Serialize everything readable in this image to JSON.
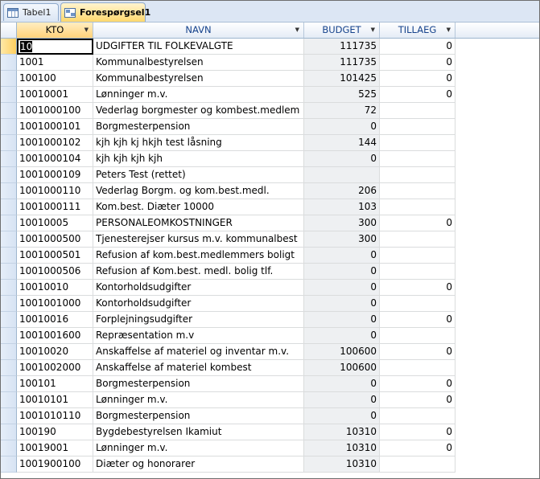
{
  "tabs": [
    {
      "label": "Tabel1",
      "icon": "table-icon",
      "active": false
    },
    {
      "label": "Forespørgsel1",
      "icon": "query-icon",
      "active": true
    }
  ],
  "columns": [
    {
      "label": "KTO"
    },
    {
      "label": "NAVN"
    },
    {
      "label": "BUDGET"
    },
    {
      "label": "TILLAEG"
    }
  ],
  "rows": [
    {
      "kto": "10",
      "navn": "UDGIFTER TIL FOLKEVALGTE",
      "budget": "111735",
      "tillaeg": "0"
    },
    {
      "kto": "1001",
      "navn": "Kommunalbestyrelsen",
      "budget": "111735",
      "tillaeg": "0"
    },
    {
      "kto": "100100",
      "navn": "Kommunalbestyrelsen",
      "budget": "101425",
      "tillaeg": "0"
    },
    {
      "kto": "10010001",
      "navn": "Lønninger m.v.",
      "budget": "525",
      "tillaeg": "0"
    },
    {
      "kto": "1001000100",
      "navn": "Vederlag borgmester og kombest.medlem",
      "budget": "72",
      "tillaeg": ""
    },
    {
      "kto": "1001000101",
      "navn": "Borgmesterpension",
      "budget": "0",
      "tillaeg": ""
    },
    {
      "kto": "1001000102",
      "navn": "kjh kjh kj hkjh test låsning",
      "budget": "144",
      "tillaeg": ""
    },
    {
      "kto": "1001000104",
      "navn": "kjh kjh kjh kjh",
      "budget": "0",
      "tillaeg": ""
    },
    {
      "kto": "1001000109",
      "navn": "Peters Test (rettet)",
      "budget": "",
      "tillaeg": ""
    },
    {
      "kto": "1001000110",
      "navn": "Vederlag Borgm. og kom.best.medl.",
      "budget": "206",
      "tillaeg": ""
    },
    {
      "kto": "1001000111",
      "navn": "Kom.best. Diæter 10000",
      "budget": "103",
      "tillaeg": ""
    },
    {
      "kto": "10010005",
      "navn": "PERSONALEOMKOSTNINGER",
      "budget": "300",
      "tillaeg": "0"
    },
    {
      "kto": "1001000500",
      "navn": "Tjenesterejser kursus m.v. kommunalbest",
      "budget": "300",
      "tillaeg": ""
    },
    {
      "kto": "1001000501",
      "navn": "Refusion af kom.best.medlemmers boligt",
      "budget": "0",
      "tillaeg": ""
    },
    {
      "kto": "1001000506",
      "navn": "Refusion af Kom.best. medl. bolig tlf.",
      "budget": "0",
      "tillaeg": ""
    },
    {
      "kto": "10010010",
      "navn": "Kontorholdsudgifter",
      "budget": "0",
      "tillaeg": "0"
    },
    {
      "kto": "1001001000",
      "navn": "Kontorholdsudgifter",
      "budget": "0",
      "tillaeg": ""
    },
    {
      "kto": "10010016",
      "navn": "Forplejningsudgifter",
      "budget": "0",
      "tillaeg": "0"
    },
    {
      "kto": "1001001600",
      "navn": "Repræsentation m.v",
      "budget": "0",
      "tillaeg": ""
    },
    {
      "kto": "10010020",
      "navn": "Anskaffelse af materiel og inventar m.v.",
      "budget": "100600",
      "tillaeg": "0"
    },
    {
      "kto": "1001002000",
      "navn": "Anskaffelse af materiel kombest",
      "budget": "100600",
      "tillaeg": ""
    },
    {
      "kto": "100101",
      "navn": "Borgmesterpension",
      "budget": "0",
      "tillaeg": "0"
    },
    {
      "kto": "10010101",
      "navn": "Lønninger m.v.",
      "budget": "0",
      "tillaeg": "0"
    },
    {
      "kto": "1001010110",
      "navn": "Borgmesterpension",
      "budget": "0",
      "tillaeg": ""
    },
    {
      "kto": "100190",
      "navn": "Bygdebestyrelsen Ikamiut",
      "budget": "10310",
      "tillaeg": "0"
    },
    {
      "kto": "10019001",
      "navn": "Lønninger m.v.",
      "budget": "10310",
      "tillaeg": "0"
    },
    {
      "kto": "1001900100",
      "navn": "Diæter og honorarer",
      "budget": "10310",
      "tillaeg": ""
    }
  ]
}
